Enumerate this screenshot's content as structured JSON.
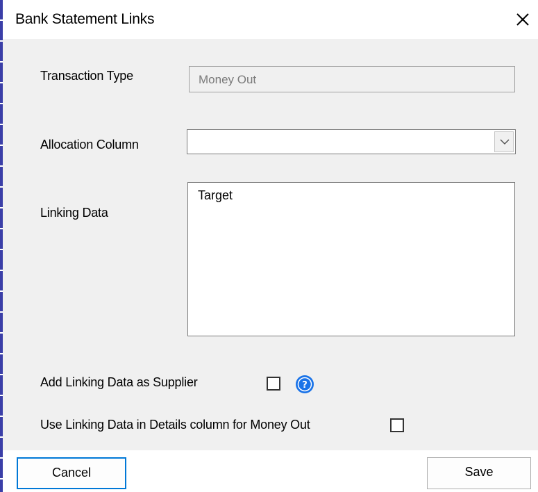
{
  "window": {
    "title": "Bank Statement Links",
    "close_glyph": "×"
  },
  "form": {
    "transaction_type": {
      "label": "Transaction Type",
      "value": "Money Out"
    },
    "allocation_column": {
      "label": "Allocation Column",
      "value": ""
    },
    "linking_data": {
      "label": "Linking Data",
      "value": "Target"
    },
    "add_as_supplier": {
      "label": "Add Linking Data as Supplier",
      "checked": false
    },
    "use_in_details": {
      "label": "Use Linking Data in Details column for Money Out",
      "checked": false
    }
  },
  "buttons": {
    "cancel": "Cancel",
    "save": "Save"
  },
  "icons": {
    "close": "close-icon",
    "dropdown": "chevron-down-icon",
    "help": "help-icon"
  },
  "colors": {
    "accent": "#0078d7",
    "help_icon": "#1a73e8"
  }
}
